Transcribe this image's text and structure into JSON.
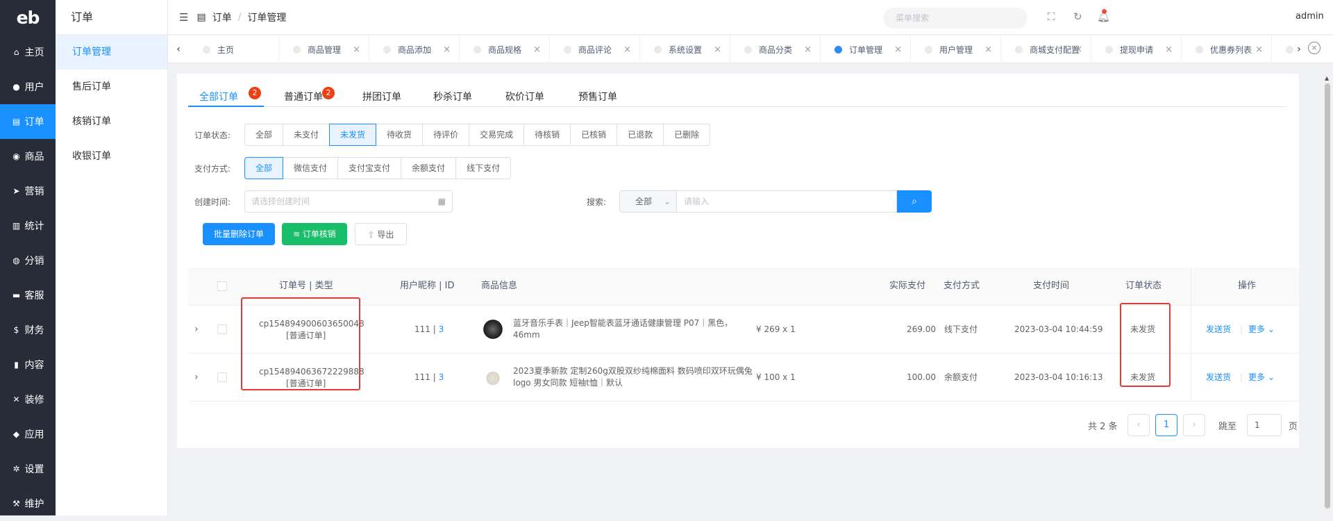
{
  "app": {
    "logo": "eb",
    "user": "admin",
    "header_search_placeholder": "菜单搜索"
  },
  "nav": {
    "items": [
      "主页",
      "用户",
      "订单",
      "商品",
      "营销",
      "统计",
      "分销",
      "客服",
      "财务",
      "内容",
      "装修",
      "应用",
      "设置",
      "维护"
    ]
  },
  "submenu": {
    "title": "订单",
    "items": [
      "订单管理",
      "售后订单",
      "核销订单",
      "收银订单"
    ]
  },
  "breadcrumb": {
    "root": "订单",
    "current": "订单管理"
  },
  "page_tabs": [
    "主页",
    "商品管理",
    "商品添加",
    "商品规格",
    "商品评论",
    "系统设置",
    "商品分类",
    "订单管理",
    "用户管理",
    "商城支付配置",
    "提现申请",
    "优惠券列表",
    ""
  ],
  "order_tabs": [
    {
      "label": "全部订单",
      "badge": "2"
    },
    {
      "label": "普通订单",
      "badge": "2"
    },
    {
      "label": "拼团订单",
      "badge": ""
    },
    {
      "label": "秒杀订单",
      "badge": ""
    },
    {
      "label": "砍价订单",
      "badge": ""
    },
    {
      "label": "预售订单",
      "badge": ""
    }
  ],
  "filters": {
    "status_label": "订单状态:",
    "status_options": [
      "全部",
      "未支付",
      "未发货",
      "待收货",
      "待评价",
      "交易完成",
      "待核销",
      "已核销",
      "已退款",
      "已删除"
    ],
    "status_selected": "未发货",
    "pay_label": "支付方式:",
    "pay_options": [
      "全部",
      "微信支付",
      "支付宝支付",
      "余额支付",
      "线下支付"
    ],
    "pay_selected": "全部",
    "date_label": "创建时间:",
    "date_placeholder": "请选择创建时间",
    "search_label": "搜索:",
    "search_scope": "全部",
    "search_placeholder": "请输入"
  },
  "actions": {
    "batch_delete": "批量删除订单",
    "verify": "订单核销",
    "export": "导出"
  },
  "table": {
    "headers": {
      "order": "订单号 | 类型",
      "user": "用户昵称 | ID",
      "product": "商品信息",
      "paid": "实际支付",
      "pay_method": "支付方式",
      "pay_time": "支付时间",
      "status": "订单状态",
      "ops": "操作"
    },
    "rows": [
      {
        "order_no": "cp154894900603650048",
        "type": "[普通订单]",
        "nickname": "111",
        "uid": "3",
        "product_image": "smartwatch",
        "product_name": "蓝牙音乐手表｜Jeep智能表蓝牙通话健康管理 P07｜黑色，46mm",
        "price_qty": "¥ 269 x 1",
        "paid": "269.00",
        "pay_method": "线下支付",
        "pay_time": "2023-03-04 10:44:59",
        "status": "未发货",
        "op_ship": "发送货",
        "op_more": "更多"
      },
      {
        "order_no": "cp154894063672229888",
        "type": "[普通订单]",
        "nickname": "111",
        "uid": "3",
        "product_image": "tshirt",
        "product_name": "2023夏季新款 定制260g双股双纱纯棉面料 数码喷印双环玩偶兔logo 男女同款 短袖t恤｜默认",
        "price_qty": "¥ 100 x 1",
        "paid": "100.00",
        "pay_method": "余额支付",
        "pay_time": "2023-03-04 10:16:13",
        "status": "未发货",
        "op_ship": "发送货",
        "op_more": "更多"
      }
    ]
  },
  "pagination": {
    "total": "共 2 条",
    "current": "1",
    "goto_label": "跳至",
    "goto_value": "1",
    "page_suffix": "页"
  },
  "colors": {
    "primary": "#1890ff",
    "sidebar": "#272c38",
    "success": "#19be6b",
    "badge": "#ed4014",
    "highlight": "#e53935"
  }
}
